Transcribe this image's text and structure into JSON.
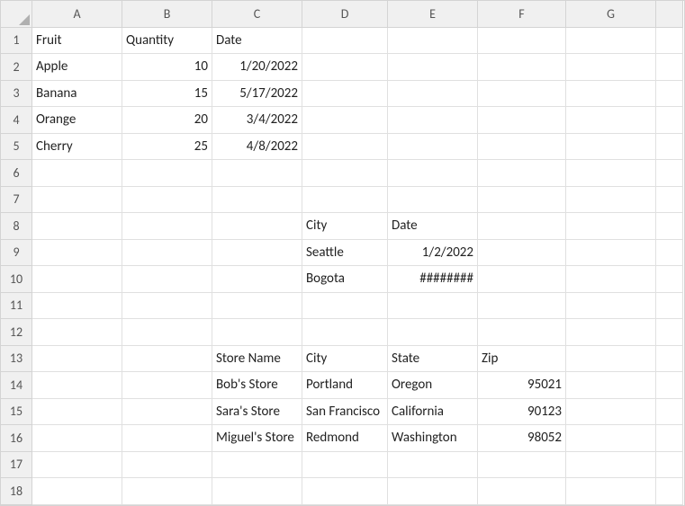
{
  "columns": [
    "A",
    "B",
    "C",
    "D",
    "E",
    "F",
    "G"
  ],
  "rowCount": 18,
  "cells": {
    "A1": {
      "v": "Fruit",
      "a": "txt"
    },
    "B1": {
      "v": "Quantity",
      "a": "txt"
    },
    "C1": {
      "v": "Date",
      "a": "txt"
    },
    "A2": {
      "v": "Apple",
      "a": "txt"
    },
    "B2": {
      "v": "10",
      "a": "num"
    },
    "C2": {
      "v": "1/20/2022",
      "a": "num"
    },
    "A3": {
      "v": "Banana",
      "a": "txt"
    },
    "B3": {
      "v": "15",
      "a": "num"
    },
    "C3": {
      "v": "5/17/2022",
      "a": "num"
    },
    "A4": {
      "v": "Orange",
      "a": "txt"
    },
    "B4": {
      "v": "20",
      "a": "num"
    },
    "C4": {
      "v": "3/4/2022",
      "a": "num"
    },
    "A5": {
      "v": "Cherry",
      "a": "txt"
    },
    "B5": {
      "v": "25",
      "a": "num"
    },
    "C5": {
      "v": "4/8/2022",
      "a": "num"
    },
    "D8": {
      "v": "City",
      "a": "txt"
    },
    "E8": {
      "v": "Date",
      "a": "txt"
    },
    "D9": {
      "v": "Seattle",
      "a": "txt"
    },
    "E9": {
      "v": "1/2/2022",
      "a": "num"
    },
    "D10": {
      "v": "Bogota",
      "a": "txt"
    },
    "E10": {
      "v": "########",
      "a": "num"
    },
    "C13": {
      "v": "Store Name",
      "a": "txt"
    },
    "D13": {
      "v": "City",
      "a": "txt"
    },
    "E13": {
      "v": "State",
      "a": "txt"
    },
    "F13": {
      "v": "Zip",
      "a": "txt"
    },
    "C14": {
      "v": "Bob's Store",
      "a": "txt"
    },
    "D14": {
      "v": "Portland",
      "a": "txt"
    },
    "E14": {
      "v": "Oregon",
      "a": "txt"
    },
    "F14": {
      "v": "95021",
      "a": "num"
    },
    "C15": {
      "v": "Sara's Store",
      "a": "txt"
    },
    "D15": {
      "v": "San Francisco",
      "a": "txt"
    },
    "E15": {
      "v": "California",
      "a": "txt"
    },
    "F15": {
      "v": "90123",
      "a": "num"
    },
    "C16": {
      "v": "Miguel's Store",
      "a": "txt"
    },
    "D16": {
      "v": "Redmond",
      "a": "txt"
    },
    "E16": {
      "v": "Washington",
      "a": "txt"
    },
    "F16": {
      "v": "98052",
      "a": "num"
    }
  },
  "chart_data": [
    {
      "type": "table",
      "title": "Fruit Quantities",
      "columns": [
        "Fruit",
        "Quantity",
        "Date"
      ],
      "rows": [
        [
          "Apple",
          10,
          "1/20/2022"
        ],
        [
          "Banana",
          15,
          "5/17/2022"
        ],
        [
          "Orange",
          20,
          "3/4/2022"
        ],
        [
          "Cherry",
          25,
          "4/8/2022"
        ]
      ]
    },
    {
      "type": "table",
      "title": "City Dates",
      "columns": [
        "City",
        "Date"
      ],
      "rows": [
        [
          "Seattle",
          "1/2/2022"
        ],
        [
          "Bogota",
          "########"
        ]
      ]
    },
    {
      "type": "table",
      "title": "Stores",
      "columns": [
        "Store Name",
        "City",
        "State",
        "Zip"
      ],
      "rows": [
        [
          "Bob's Store",
          "Portland",
          "Oregon",
          95021
        ],
        [
          "Sara's Store",
          "San Francisco",
          "California",
          90123
        ],
        [
          "Miguel's Store",
          "Redmond",
          "Washington",
          98052
        ]
      ]
    }
  ]
}
